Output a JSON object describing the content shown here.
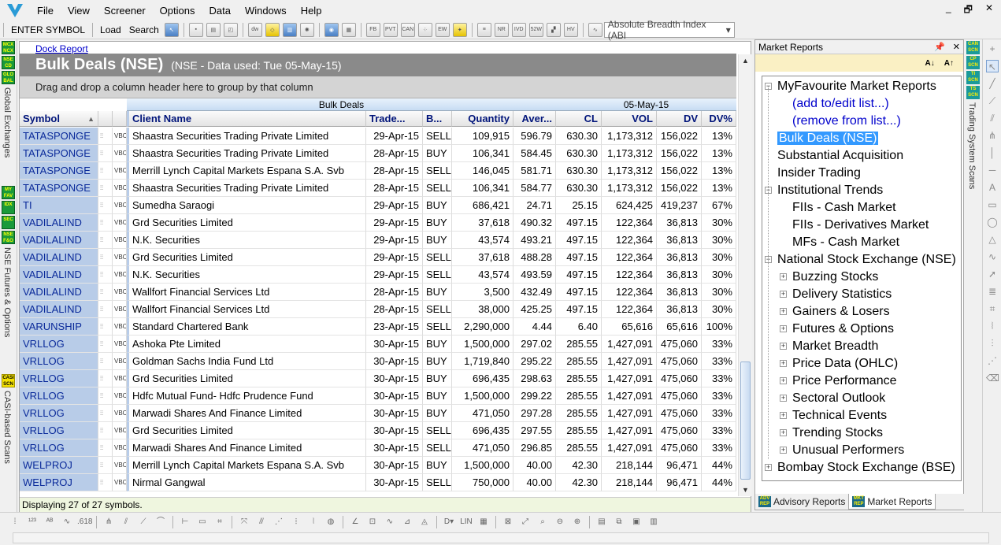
{
  "menu": [
    "File",
    "View",
    "Screener",
    "Options",
    "Data",
    "Windows",
    "Help"
  ],
  "window_buttons": [
    "_",
    "🗗",
    "✕"
  ],
  "toolbar": {
    "enter_symbol": "ENTER SYMBOL",
    "load": "Load",
    "search": "Search",
    "indicator_combo": "Absolute Breadth Index (ABI"
  },
  "left_strip": {
    "badges_top": [
      "MCX NCX",
      "NSE CD",
      "GLO BAL"
    ],
    "label_top": "Global Exchanges",
    "badges_mid": [
      "MY FAV",
      "IDX",
      "SEC",
      "NSE F&O"
    ],
    "label_mid": "NSE Futures & Options",
    "badges_bottom": [
      "CASI SCN"
    ],
    "label_bottom": "CASI-based Scans"
  },
  "report": {
    "dock_link": "Dock Report",
    "title": "Bulk Deals (NSE)",
    "subtitle": "(NSE - Data used: Tue 05-May-15)",
    "group_hint": "Drag and drop a column header here to group by that column",
    "band_bulk": "Bulk Deals",
    "band_date": "05-May-15",
    "columns": [
      "Symbol",
      "Client Name",
      "Trade...",
      "B...",
      "Quantity",
      "Aver...",
      "CL",
      "VOL",
      "DV",
      "DV%"
    ],
    "sort_indicator": "▲",
    "rows": [
      [
        "TATASPONGE",
        "Shaastra Securities Trading Private Limited",
        "29-Apr-15",
        "SELL",
        "109,915",
        "596.79",
        "630.30",
        "1,173,312",
        "156,022",
        "13%"
      ],
      [
        "TATASPONGE",
        "Shaastra Securities Trading Private Limited",
        "28-Apr-15",
        "BUY",
        "106,341",
        "584.45",
        "630.30",
        "1,173,312",
        "156,022",
        "13%"
      ],
      [
        "TATASPONGE",
        "Merrill Lynch Capital Markets Espana S.A. Svb",
        "28-Apr-15",
        "SELL",
        "146,045",
        "581.71",
        "630.30",
        "1,173,312",
        "156,022",
        "13%"
      ],
      [
        "TATASPONGE",
        "Shaastra Securities Trading Private Limited",
        "28-Apr-15",
        "SELL",
        "106,341",
        "584.77",
        "630.30",
        "1,173,312",
        "156,022",
        "13%"
      ],
      [
        "TI",
        "Sumedha Saraogi",
        "29-Apr-15",
        "BUY",
        "686,421",
        "24.71",
        "25.15",
        "624,425",
        "419,237",
        "67%"
      ],
      [
        "VADILALIND",
        "Grd Securities Limited",
        "29-Apr-15",
        "BUY",
        "37,618",
        "490.32",
        "497.15",
        "122,364",
        "36,813",
        "30%"
      ],
      [
        "VADILALIND",
        "N.K. Securities",
        "29-Apr-15",
        "BUY",
        "43,574",
        "493.21",
        "497.15",
        "122,364",
        "36,813",
        "30%"
      ],
      [
        "VADILALIND",
        "Grd Securities Limited",
        "29-Apr-15",
        "SELL",
        "37,618",
        "488.28",
        "497.15",
        "122,364",
        "36,813",
        "30%"
      ],
      [
        "VADILALIND",
        "N.K. Securities",
        "29-Apr-15",
        "SELL",
        "43,574",
        "493.59",
        "497.15",
        "122,364",
        "36,813",
        "30%"
      ],
      [
        "VADILALIND",
        "Wallfort Financial Services Ltd",
        "28-Apr-15",
        "BUY",
        "3,500",
        "432.49",
        "497.15",
        "122,364",
        "36,813",
        "30%"
      ],
      [
        "VADILALIND",
        "Wallfort Financial Services Ltd",
        "28-Apr-15",
        "SELL",
        "38,000",
        "425.25",
        "497.15",
        "122,364",
        "36,813",
        "30%"
      ],
      [
        "VARUNSHIP",
        "Standard Chartered Bank",
        "23-Apr-15",
        "SELL",
        "2,290,000",
        "4.44",
        "6.40",
        "65,616",
        "65,616",
        "100%"
      ],
      [
        "VRLLOG",
        "Ashoka Pte Limited",
        "30-Apr-15",
        "BUY",
        "1,500,000",
        "297.02",
        "285.55",
        "1,427,091",
        "475,060",
        "33%"
      ],
      [
        "VRLLOG",
        "Goldman Sachs India Fund Ltd",
        "30-Apr-15",
        "BUY",
        "1,719,840",
        "295.22",
        "285.55",
        "1,427,091",
        "475,060",
        "33%"
      ],
      [
        "VRLLOG",
        "Grd Securities Limited",
        "30-Apr-15",
        "BUY",
        "696,435",
        "298.63",
        "285.55",
        "1,427,091",
        "475,060",
        "33%"
      ],
      [
        "VRLLOG",
        "Hdfc Mutual Fund- Hdfc Prudence Fund",
        "30-Apr-15",
        "BUY",
        "1,500,000",
        "299.22",
        "285.55",
        "1,427,091",
        "475,060",
        "33%"
      ],
      [
        "VRLLOG",
        "Marwadi Shares And Finance Limited",
        "30-Apr-15",
        "BUY",
        "471,050",
        "297.28",
        "285.55",
        "1,427,091",
        "475,060",
        "33%"
      ],
      [
        "VRLLOG",
        "Grd Securities Limited",
        "30-Apr-15",
        "SELL",
        "696,435",
        "297.55",
        "285.55",
        "1,427,091",
        "475,060",
        "33%"
      ],
      [
        "VRLLOG",
        "Marwadi Shares And Finance Limited",
        "30-Apr-15",
        "SELL",
        "471,050",
        "296.85",
        "285.55",
        "1,427,091",
        "475,060",
        "33%"
      ],
      [
        "WELPROJ",
        "Merrill Lynch Capital Markets Espana S.A. Svb",
        "30-Apr-15",
        "BUY",
        "1,500,000",
        "40.00",
        "42.30",
        "218,144",
        "96,471",
        "44%"
      ],
      [
        "WELPROJ",
        "Nirmal Gangwal",
        "30-Apr-15",
        "SELL",
        "750,000",
        "40.00",
        "42.30",
        "218,144",
        "96,471",
        "44%"
      ]
    ],
    "status": "Displaying 27 of 27 symbols."
  },
  "market_reports": {
    "panel_title": "Market Reports",
    "pin": "📌",
    "close": "✕",
    "sort_asc": "A↓",
    "sort_desc": "A↑",
    "tree": [
      {
        "label": "MyFavourite Market Reports",
        "level": 0,
        "exp": "−"
      },
      {
        "label": "(add to/edit list...)",
        "level": 1,
        "link": true
      },
      {
        "label": "(remove from list...)",
        "level": 1,
        "link": true
      },
      {
        "label": "Bulk Deals (NSE)",
        "level": 0,
        "selected": true
      },
      {
        "label": "Substantial Acquisition",
        "level": 0
      },
      {
        "label": "Insider Trading",
        "level": 0
      },
      {
        "label": "Institutional Trends",
        "level": 0,
        "exp": "−"
      },
      {
        "label": "FIIs - Cash Market",
        "level": 1
      },
      {
        "label": "FIIs - Derivatives Market",
        "level": 1
      },
      {
        "label": "MFs - Cash Market",
        "level": 1
      },
      {
        "label": "National Stock Exchange (NSE)",
        "level": 0,
        "exp": "−"
      },
      {
        "label": "Buzzing Stocks",
        "level": 1,
        "exp": "+"
      },
      {
        "label": "Delivery Statistics",
        "level": 1,
        "exp": "+"
      },
      {
        "label": "Gainers & Losers",
        "level": 1,
        "exp": "+"
      },
      {
        "label": "Futures & Options",
        "level": 1,
        "exp": "+"
      },
      {
        "label": "Market Breadth",
        "level": 1,
        "exp": "+"
      },
      {
        "label": "Price Data (OHLC)",
        "level": 1,
        "exp": "+"
      },
      {
        "label": "Price Performance",
        "level": 1,
        "exp": "+"
      },
      {
        "label": "Sectoral Outlook",
        "level": 1,
        "exp": "+"
      },
      {
        "label": "Technical Events",
        "level": 1,
        "exp": "+"
      },
      {
        "label": "Trending Stocks",
        "level": 1,
        "exp": "+"
      },
      {
        "label": "Unusual Performers",
        "level": 1,
        "exp": "+"
      },
      {
        "label": "Bombay Stock Exchange (BSE)",
        "level": 0,
        "exp": "+"
      }
    ],
    "tab_advisory": "Advisory Reports",
    "tab_market": "Market Reports",
    "tab_advisory_badge": "ADV REP",
    "tab_market_badge": "MKT REP"
  },
  "right_strip": {
    "badges": [
      "CAN SCN",
      "CP SCN",
      "TI SCN",
      "TS SCN"
    ],
    "label": "Trading System Scans"
  }
}
